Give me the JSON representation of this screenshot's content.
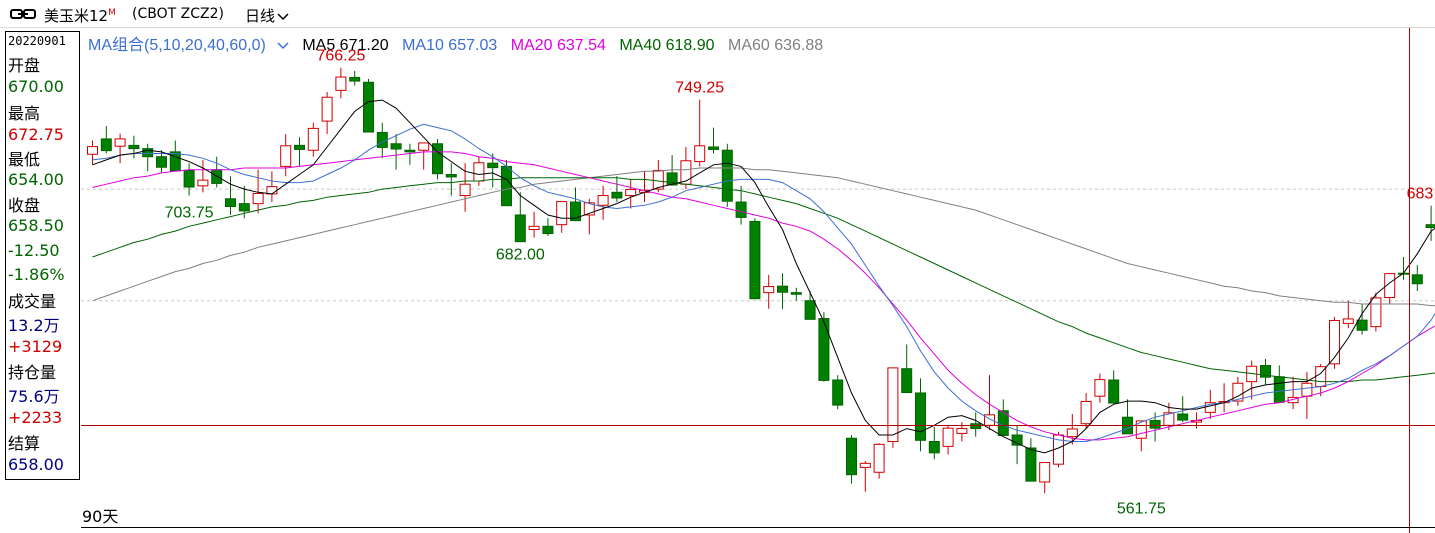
{
  "header": {
    "link_icon": "link-icon",
    "symbol_name": "美玉米12",
    "symbol_flag": "M",
    "contract_code": "(CBOT ZCZ2)",
    "period": "日线",
    "period_icon": "chevron-down-icon"
  },
  "info_panel": {
    "date": "20220901",
    "open_label": "开盘",
    "open": "670.00",
    "high_label": "最高",
    "high": "672.75",
    "low_label": "最低",
    "low": "654.00",
    "close_label": "收盘",
    "close": "658.50",
    "change": "-12.50",
    "change_pct": "-1.86%",
    "volume_label": "成交量",
    "volume": "13.2万",
    "volume_change": "+3129",
    "oi_label": "持仓量",
    "open_interest": "75.6万",
    "oi_change": "+2233",
    "settle_label": "结算",
    "settle": "658.00"
  },
  "ma_legend": {
    "group": "MA组合(5,10,20,40,60,0)",
    "ma5": "MA5 671.20",
    "ma10": "MA10 657.03",
    "ma20": "MA20 637.54",
    "ma40": "MA40 618.90",
    "ma60": "MA60 636.88"
  },
  "footer": {
    "days": "90天"
  },
  "colors": {
    "up": "#d00000",
    "down": "#006400",
    "down_fill": "#008000",
    "ma5": "#000000",
    "ma10": "#3c6fd0",
    "ma20": "#e000e0",
    "ma40": "#006400",
    "ma60": "#808080",
    "crosshair": "#b00000"
  },
  "chart_data": {
    "type": "candlestick",
    "candles": [
      [
        715.5,
        724,
        709,
        720.25
      ],
      [
        725,
        733,
        716,
        717.75
      ],
      [
        720.5,
        728.25,
        710,
        725
      ],
      [
        721,
        727,
        713,
        719
      ],
      [
        719,
        722,
        705,
        714
      ],
      [
        714,
        718,
        704,
        707.5
      ],
      [
        717,
        724,
        705,
        705.25
      ],
      [
        705.5,
        710,
        690,
        695.25
      ],
      [
        696,
        712,
        692,
        699.5
      ],
      [
        706,
        714,
        695,
        697.5
      ],
      [
        688,
        702,
        678,
        683.25
      ],
      [
        685,
        696,
        676,
        680.5
      ],
      [
        685,
        706,
        679,
        691.25
      ],
      [
        691,
        705,
        686,
        695.5
      ],
      [
        708,
        728,
        702,
        720.75
      ],
      [
        721,
        726,
        708,
        718.5
      ],
      [
        718,
        735,
        714,
        731.5
      ],
      [
        736,
        754,
        728,
        750.75
      ],
      [
        755,
        769,
        750,
        763.25
      ],
      [
        763,
        767,
        758,
        760.75
      ],
      [
        760,
        762,
        730,
        729.25
      ],
      [
        729,
        735,
        713,
        719.75
      ],
      [
        722,
        728,
        706,
        718.75
      ],
      [
        718,
        722,
        709,
        717
      ],
      [
        718,
        722,
        706,
        722.5
      ],
      [
        722,
        725,
        700,
        703.5
      ],
      [
        703,
        710,
        690,
        701.5
      ],
      [
        690,
        710,
        680,
        697
      ],
      [
        699,
        714,
        696,
        710.25
      ],
      [
        710,
        716,
        695,
        707.25
      ],
      [
        708,
        712,
        686,
        683.75
      ],
      [
        678,
        692,
        664,
        661.5
      ],
      [
        669,
        680,
        664,
        671
      ],
      [
        671,
        676,
        665,
        666.5
      ],
      [
        672,
        685,
        667,
        686.25
      ],
      [
        686,
        695,
        677,
        674.5
      ],
      [
        678,
        688,
        666,
        685.5
      ],
      [
        684,
        696,
        675,
        690
      ],
      [
        692,
        702,
        686,
        688.5
      ],
      [
        690,
        700,
        682,
        693.75
      ],
      [
        692,
        705,
        686,
        693.25
      ],
      [
        694,
        712,
        692,
        705.5
      ],
      [
        704,
        715,
        697,
        696.5
      ],
      [
        697,
        720,
        694,
        711.5
      ],
      [
        711,
        749.25,
        708,
        720.75
      ],
      [
        720,
        732,
        716,
        718.5
      ],
      [
        718,
        722,
        683,
        686.5
      ],
      [
        686,
        696,
        672,
        676.5
      ],
      [
        674,
        676,
        627,
        626.25
      ],
      [
        630,
        641,
        620,
        633.75
      ],
      [
        634,
        642,
        620,
        630.25
      ],
      [
        630,
        633,
        625,
        629
      ],
      [
        625,
        631,
        615,
        613.5
      ],
      [
        614,
        618,
        575,
        575.75
      ],
      [
        576,
        579,
        558,
        560.5
      ],
      [
        540,
        542,
        512,
        517.5
      ],
      [
        522,
        526,
        507,
        524.5
      ],
      [
        519,
        537,
        515,
        536.25
      ],
      [
        538,
        583,
        534,
        583.5
      ],
      [
        583,
        598,
        568,
        568.25
      ],
      [
        568,
        577,
        532,
        538.75
      ],
      [
        538,
        547,
        527,
        531
      ],
      [
        535,
        548,
        530,
        546.25
      ],
      [
        543,
        550,
        538,
        546
      ],
      [
        549,
        556,
        541,
        546
      ],
      [
        548,
        579,
        545,
        554.5
      ],
      [
        557,
        564,
        548,
        541.75
      ],
      [
        542,
        548,
        524,
        535.75
      ],
      [
        534,
        540,
        515,
        513.5
      ],
      [
        513,
        521,
        506,
        525
      ],
      [
        524,
        544,
        522,
        542
      ],
      [
        541,
        555,
        536,
        545.75
      ],
      [
        549,
        568,
        546,
        562.75
      ],
      [
        566,
        580,
        562,
        576.25
      ],
      [
        576,
        582,
        562,
        561.75
      ],
      [
        553,
        564,
        546,
        542.75
      ],
      [
        540,
        544,
        532,
        550.75
      ],
      [
        551,
        556,
        538,
        546.25
      ],
      [
        548,
        562,
        545,
        555.75
      ],
      [
        555,
        566,
        550,
        551.25
      ],
      [
        550,
        556,
        546,
        551
      ],
      [
        556,
        570,
        552,
        562
      ],
      [
        562,
        574,
        556,
        562.75
      ],
      [
        563,
        578,
        560,
        574
      ],
      [
        575,
        588,
        564,
        584.5
      ],
      [
        585,
        589,
        573,
        577.75
      ],
      [
        578,
        585,
        565,
        562.25
      ],
      [
        562,
        578,
        558,
        565.25
      ],
      [
        566,
        581,
        552,
        574
      ],
      [
        572,
        586,
        566,
        584.25
      ],
      [
        586,
        615,
        583,
        612.75
      ],
      [
        611,
        625,
        608,
        613.75
      ],
      [
        613,
        623,
        604,
        606.75
      ],
      [
        609,
        630,
        606,
        626.75
      ],
      [
        627,
        642,
        623,
        641.75
      ],
      [
        642,
        652,
        638,
        641.5
      ],
      [
        641,
        647,
        631,
        635.5
      ],
      [
        672,
        683.75,
        662,
        670.25
      ],
      [
        670,
        676,
        658,
        660.75
      ],
      [
        670,
        672.75,
        654,
        658.5
      ]
    ],
    "ma5": [
      709,
      712,
      715,
      716,
      718,
      717,
      714,
      711,
      707,
      702,
      697,
      694,
      692,
      691,
      697,
      703,
      709,
      720,
      731,
      742,
      748,
      749,
      744,
      735,
      726,
      717,
      711,
      705,
      703,
      704,
      700,
      690,
      684,
      678,
      676,
      676,
      679,
      682,
      685,
      689,
      692,
      695,
      697,
      699,
      704,
      709,
      710,
      708,
      698,
      683,
      669,
      648,
      630,
      612,
      590,
      568,
      551,
      542,
      542,
      546,
      544,
      548,
      553,
      554,
      551,
      546,
      541,
      537,
      533,
      531,
      534,
      538,
      546,
      556,
      561,
      563,
      563,
      562,
      559,
      558,
      558,
      560,
      562,
      566,
      571,
      573,
      574,
      575,
      575,
      580,
      590,
      602,
      617,
      629,
      636,
      642,
      654,
      668,
      674,
      671
    ],
    "ma10": [
      712,
      713,
      715,
      716,
      716,
      716,
      716,
      715,
      713,
      710,
      706,
      703,
      701,
      699,
      698,
      698,
      699,
      703,
      707,
      712,
      718,
      723,
      727,
      731,
      734,
      732,
      730,
      725,
      719,
      714,
      708,
      701,
      696,
      692,
      690,
      688,
      685,
      683,
      682,
      683,
      684,
      686,
      689,
      693,
      695,
      697,
      699,
      700,
      700,
      700,
      698,
      693,
      688,
      680,
      670,
      660,
      647,
      634,
      622,
      609,
      594,
      581,
      571,
      563,
      557,
      552,
      548,
      545,
      543,
      541,
      539,
      538,
      538,
      540,
      543,
      546,
      550,
      553,
      555,
      557,
      559,
      561,
      562,
      564,
      566,
      568,
      569,
      570,
      571,
      572,
      574,
      577,
      582,
      586,
      591,
      597,
      603,
      613,
      627,
      635
    ],
    "ma20": [
      695,
      697,
      699,
      701,
      702,
      704,
      705,
      706,
      706,
      706,
      706,
      707,
      707,
      707,
      707,
      708,
      709,
      710,
      711,
      712,
      713,
      714,
      715,
      716,
      717,
      717,
      717,
      716,
      714,
      713,
      711,
      710,
      709,
      707,
      705,
      703,
      701,
      699,
      697,
      695,
      693,
      691,
      689,
      688,
      686,
      684,
      682,
      680,
      678,
      676,
      673,
      671,
      668,
      663,
      657,
      650,
      642,
      633,
      623,
      613,
      602,
      592,
      582,
      574,
      567,
      561,
      556,
      551,
      547,
      544,
      542,
      540,
      539,
      539,
      540,
      541,
      543,
      545,
      547,
      549,
      551,
      553,
      555,
      557,
      559,
      561,
      562,
      564,
      566,
      568,
      571,
      575,
      580,
      585,
      591,
      597,
      603,
      608,
      613,
      617
    ],
    "ma40": [
      652,
      655,
      658,
      661,
      663,
      666,
      668,
      671,
      673,
      675,
      677,
      679,
      681,
      683,
      684,
      686,
      687,
      689,
      690,
      691,
      692,
      694,
      695,
      696,
      697,
      698,
      698,
      699,
      699,
      700,
      700,
      701,
      701,
      701,
      701,
      701,
      701,
      701,
      701,
      700,
      700,
      699,
      698,
      697,
      696,
      695,
      694,
      693,
      691,
      689,
      687,
      685,
      682,
      679,
      676,
      672,
      668,
      664,
      660,
      656,
      652,
      648,
      644,
      640,
      636,
      632,
      628,
      624,
      620,
      616,
      612,
      609,
      605,
      602,
      599,
      596,
      593,
      591,
      589,
      587,
      585,
      583,
      582,
      581,
      580,
      579,
      578,
      577,
      576,
      575,
      575,
      575,
      576,
      576,
      577,
      578,
      579,
      580,
      581,
      582
    ],
    "ma60": [
      625,
      628,
      631,
      634,
      637,
      640,
      643,
      645,
      648,
      650,
      653,
      655,
      658,
      660,
      662,
      664,
      666,
      668,
      670,
      672,
      674,
      676,
      678,
      680,
      682,
      684,
      686,
      688,
      690,
      692,
      694,
      695,
      697,
      698,
      699,
      700,
      701,
      702,
      703,
      704,
      705,
      705,
      706,
      706,
      707,
      707,
      707,
      707,
      706,
      706,
      705,
      704,
      703,
      702,
      701,
      699,
      697,
      695,
      693,
      691,
      689,
      687,
      685,
      683,
      681,
      678,
      675,
      672,
      669,
      666,
      663,
      660,
      657,
      654,
      651,
      648,
      646,
      644,
      642,
      640,
      638,
      636,
      634,
      633,
      631,
      630,
      628,
      627,
      626,
      625,
      624,
      624,
      623,
      623,
      623,
      623,
      623,
      622,
      622,
      622
    ],
    "annotations": [
      {
        "text": "766.25",
        "index": 18,
        "value": 769,
        "pos": "above",
        "color": "#d00000"
      },
      {
        "text": "749.25",
        "index": 44,
        "value": 749.25,
        "pos": "above",
        "color": "#d00000"
      },
      {
        "text": "703.75",
        "index": 7,
        "value": 690,
        "pos": "below",
        "color": "#006400"
      },
      {
        "text": "682.00",
        "index": 31,
        "value": 664,
        "pos": "below",
        "color": "#006400"
      },
      {
        "text": "561.75",
        "index": 76,
        "value": 507,
        "pos": "below",
        "color": "#006400"
      },
      {
        "text": "683.75",
        "index": 97,
        "value": 683.75,
        "pos": "above",
        "color": "#d00000"
      }
    ],
    "reference_lines": [
      694,
      625
    ]
  }
}
